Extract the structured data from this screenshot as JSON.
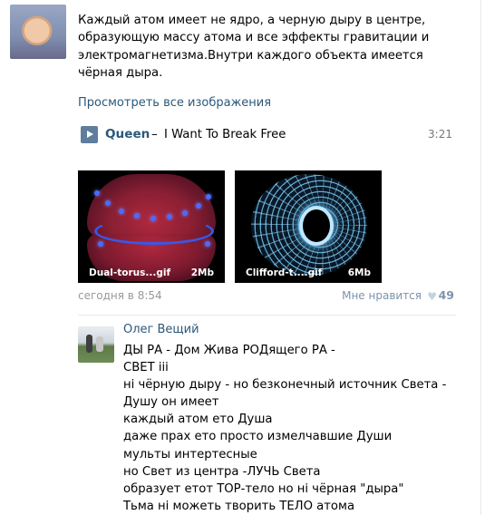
{
  "post": {
    "text": "Каждый атом имеет не ядро, а черную дыру в центре, образующую массу атома и все эффекты гравитации и электромагнетизма.Внутри каждого объекта имеется чёрная дыра.",
    "show_all_images": "Просмотреть все изображения",
    "audio": {
      "artist": "Queen",
      "dash": "–",
      "title": "I Want To Break Free",
      "duration": "3:21"
    },
    "gifs": [
      {
        "name": "Dual-torus...gif",
        "size": "2Mb"
      },
      {
        "name": "Clifford-t....gif",
        "size": "6Mb"
      }
    ],
    "date": "сегодня в 8:54",
    "like_label": "Мне нравится",
    "like_count": "49"
  },
  "comment": {
    "author": "Олег Вещий",
    "lines": [
      "ДЫ РА - Дом Жива РОДящего РА -",
      "СВЕТ iii",
      "ні чёрную дыру - но безконечный источник Света -",
      "Душу он имеет",
      "каждый атом ето Душа",
      "даже прах ето просто измелчавшие Души",
      "мульты интертесные",
      "но Свет из центра -ЛУЧЬ Света",
      "образует етот ТОР-тело но ні чёрная \"дыра\"",
      "Тьма ні можеть творить ТЕЛО атома"
    ]
  },
  "colors": {
    "link": "#2b587a",
    "meta": "#999999",
    "like": "#7c93ad",
    "play_button": "#5f7d9d"
  },
  "icons": {
    "play": "play-icon",
    "like": "heart-icon"
  }
}
